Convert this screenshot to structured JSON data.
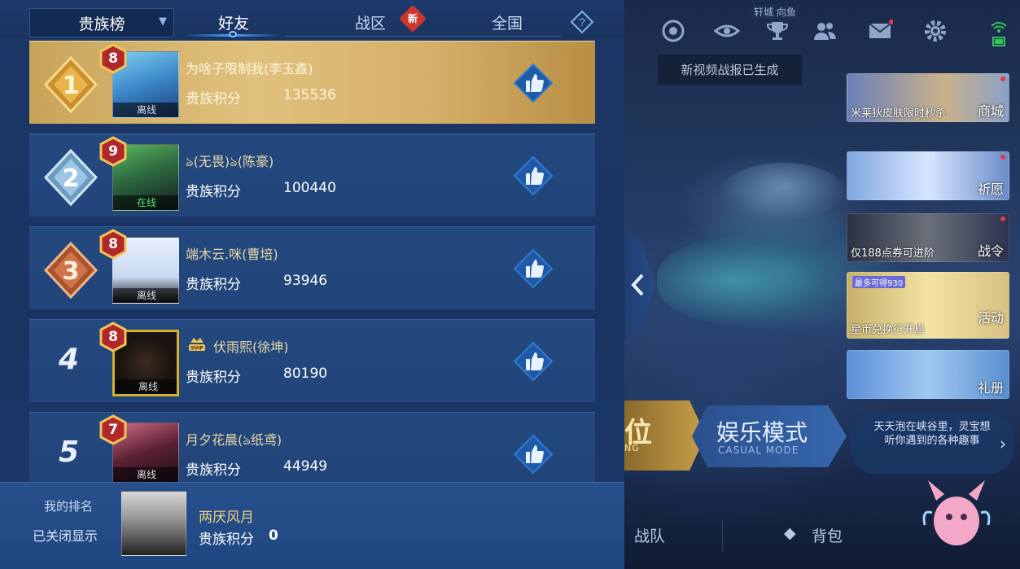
{
  "header": {
    "dropdown_label": "贵族榜",
    "tabs": [
      {
        "label": "好友",
        "active": true
      },
      {
        "label": "战区",
        "badge": "新"
      },
      {
        "label": "全国"
      }
    ],
    "help_icon": "question-icon"
  },
  "leaderboard": [
    {
      "rank": "1",
      "level": "8",
      "name": "为啥子限制我(李玉鑫)",
      "score_label": "贵族积分",
      "score": "135536",
      "status": "离线"
    },
    {
      "rank": "2",
      "level": "9",
      "name": "ঌ(无畏)ঌ(陈豪)",
      "score_label": "贵族积分",
      "score": "100440",
      "status": "在线"
    },
    {
      "rank": "3",
      "level": "8",
      "name": "端木云.咪(曹培)",
      "score_label": "贵族积分",
      "score": "93946",
      "status": "离线"
    },
    {
      "rank": "4",
      "level": "8",
      "name": "伏雨熙(徐坤)",
      "score_label": "贵族积分",
      "score": "80190",
      "status": "离线",
      "svip": true
    },
    {
      "rank": "5",
      "level": "7",
      "name": "月夕花晨(ঌ纸鸢)",
      "score_label": "贵族积分",
      "score": "44949",
      "status": "离线"
    }
  ],
  "my_rank": {
    "label": "我的排名",
    "value": "已关闭显示",
    "name": "两厌风月",
    "score_label": "贵族积分",
    "score": "0"
  },
  "game_ui": {
    "location_tag": "轩城 向鱼",
    "video_tip": "新视频战报已生成",
    "side_cards": [
      {
        "caption": "米莱狄皮肤限时秒杀",
        "tag": "商城"
      },
      {
        "caption": "",
        "tag": "祈愿"
      },
      {
        "caption": "仅188点券可进阶",
        "tag": "战令"
      },
      {
        "caption": "星币兑换行开启",
        "tag": "活动",
        "sub_badge": "最多可得930"
      },
      {
        "caption": "",
        "tag": "礼册"
      }
    ],
    "mode_rank": {
      "big": "位",
      "small": "NG"
    },
    "mode_casual": {
      "big": "娱乐模式",
      "small": "CASUAL MODE"
    },
    "bubble_tip": "天天泡在峡谷里，灵宝想听你遇到的各种趣事",
    "bottom_nav": [
      "战队",
      "背包"
    ]
  },
  "colors": {
    "panel_bg": "#1b3766",
    "first_row_gold": "#e0c17d",
    "row_bg": "#24497e",
    "online_green": "#5be36a",
    "name_gold": "#f0d080"
  }
}
